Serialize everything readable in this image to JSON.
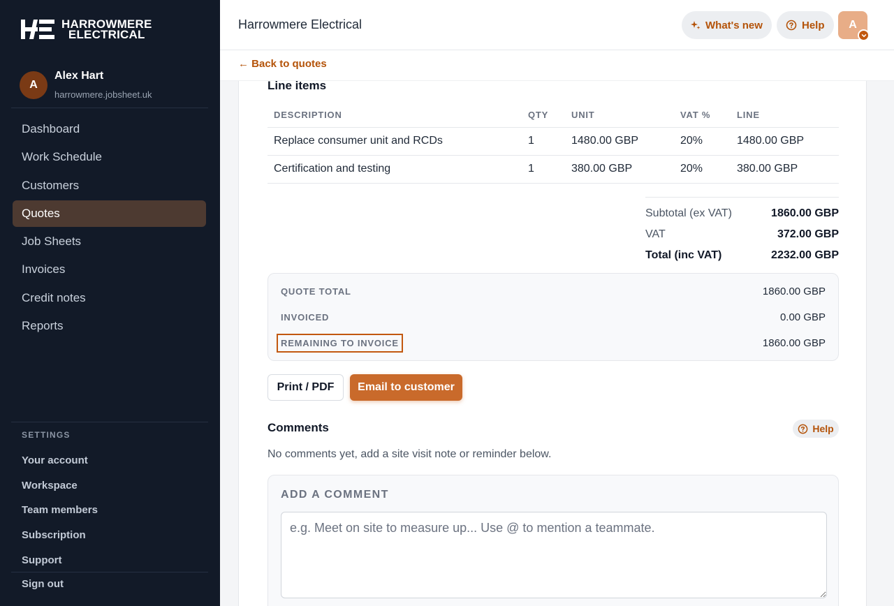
{
  "brand": {
    "line1": "HARROWMERE",
    "line2": "ELECTRICAL"
  },
  "user": {
    "initial": "A",
    "name": "Alex Hart",
    "domain": "harrowmere.jobsheet.uk"
  },
  "nav": [
    {
      "label": "Dashboard",
      "active": false
    },
    {
      "label": "Work Schedule",
      "active": false
    },
    {
      "label": "Customers",
      "active": false
    },
    {
      "label": "Quotes",
      "active": true
    },
    {
      "label": "Job Sheets",
      "active": false
    },
    {
      "label": "Invoices",
      "active": false
    },
    {
      "label": "Credit notes",
      "active": false
    },
    {
      "label": "Reports",
      "active": false
    }
  ],
  "settings": {
    "title": "SETTINGS",
    "items": [
      "Your account",
      "Workspace",
      "Team members",
      "Subscription",
      "Support"
    ],
    "sign_out": "Sign out"
  },
  "topbar": {
    "title": "Harrowmere Electrical",
    "whats_new": "What's new",
    "help": "Help",
    "avatar_initial": "A"
  },
  "back_link": "← Back to quotes",
  "line_items": {
    "title": "Line items",
    "headers": [
      "DESCRIPTION",
      "QTY",
      "UNIT",
      "VAT %",
      "LINE"
    ],
    "rows": [
      [
        "Replace consumer unit and RCDs",
        "1",
        "1480.00 GBP",
        "20%",
        "1480.00 GBP"
      ],
      [
        "Certification and testing",
        "1",
        "380.00 GBP",
        "20%",
        "380.00 GBP"
      ]
    ]
  },
  "totals": {
    "subtotal_label": "Subtotal (ex VAT)",
    "subtotal": "1860.00 GBP",
    "vat_label": "VAT",
    "vat": "372.00 GBP",
    "total_label": "Total (inc VAT)",
    "total": "2232.00 GBP"
  },
  "summary": {
    "quote_total_label": "QUOTE TOTAL",
    "quote_total": "1860.00 GBP",
    "invoiced_label": "INVOICED",
    "invoiced": "0.00 GBP",
    "remaining_label": "REMAINING TO INVOICE",
    "remaining": "1860.00 GBP"
  },
  "actions": {
    "print": "Print / PDF",
    "email": "Email to customer"
  },
  "comments": {
    "title": "Comments",
    "help": "Help",
    "empty": "No comments yet, add a site visit note or reminder below.",
    "add_title": "ADD A COMMENT",
    "placeholder": "e.g. Meet on site to measure up... Use @ to mention a teammate."
  },
  "colors": {
    "accent": "#b45309",
    "button": "#c96a2b",
    "sidebar": "#121a28",
    "active_nav": "#4d3a31"
  }
}
